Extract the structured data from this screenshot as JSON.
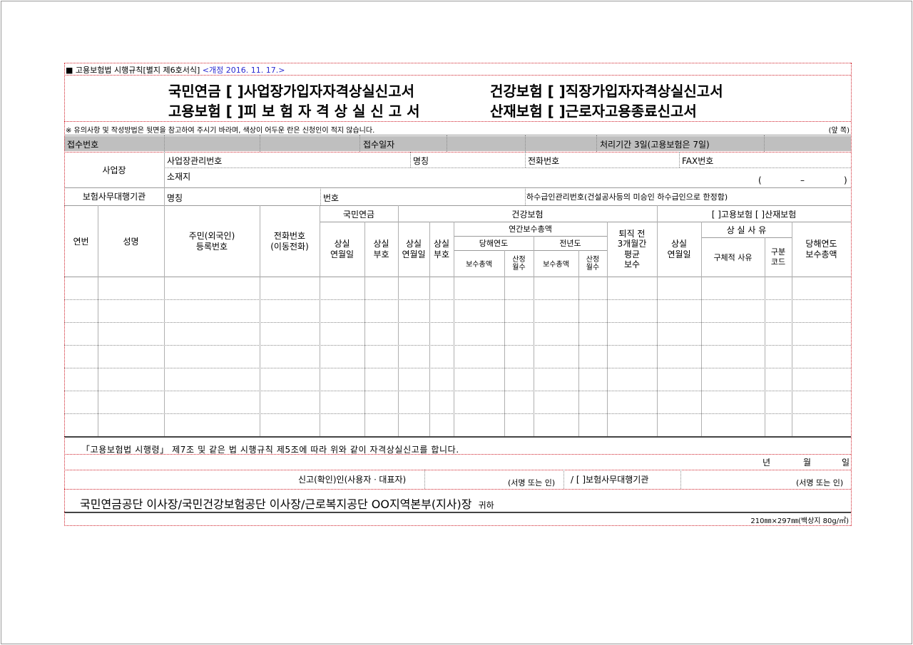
{
  "header": {
    "rule_ref": "■ 고용보험법 시행규칙[별지 제6호서식]",
    "revision": "<개정 2016. 11. 17.>"
  },
  "titles": {
    "left_top": "국민연금 [ ]사업장가입자자격상실신고서",
    "left_bottom": "고용보험 [ ]피 보 험 자 격 상 실 신 고 서",
    "right_top": "건강보험 [ ]직장가입자자격상실신고서",
    "right_bottom": "산재보험 [ ]근로자고용종료신고서"
  },
  "notice": {
    "text": "※ 유의사항 및 작성방법은 뒷면을 참고하여 주시기 바라며, 색상이 어두운 란은 신청인이 적지 않습니다.",
    "side": "(앞 쪽)"
  },
  "reception": {
    "receipt_no": "접수번호",
    "receipt_date": "접수일자",
    "processing": "처리기간 3일(고용보험은 7일)"
  },
  "workplace": {
    "label": "사업장",
    "mgmt_no": "사업장관리번호",
    "name": "명칭",
    "phone": "전화번호",
    "fax": "FAX번호",
    "address": "소재지",
    "paren_open": "(",
    "dash": "–",
    "paren_close": ")"
  },
  "agency": {
    "label": "보험사무대행기관",
    "name": "명칭",
    "number": "번호",
    "subcontract": "하수급인관리번호(건설공사등의 미승인 하수급인으로 한정함)"
  },
  "table_headers": {
    "seq": "연번",
    "name": "성명",
    "resident_no_1": "주민(외국인)",
    "resident_no_2": "등록번호",
    "phone_1": "전화번호",
    "phone_2": "(이동전화)",
    "national_pension": "국민연금",
    "np_loss_date_1": "상실",
    "np_loss_date_2": "연월일",
    "np_loss_code_1": "상실",
    "np_loss_code_2": "부호",
    "health_insurance": "건강보험",
    "hi_loss_date_1": "상실",
    "hi_loss_date_2": "연월일",
    "hi_loss_code_1": "상실",
    "hi_loss_code_2": "부호",
    "annual_pay": "연간보수총액",
    "current_year": "당해연도",
    "previous_year": "전년도",
    "pay_total_cur": "보수총액",
    "months_cur_1": "산정",
    "months_cur_2": "월수",
    "pay_total_prev": "보수총액",
    "months_prev_1": "산정",
    "months_prev_2": "월수",
    "avg_pay_1": "퇴직 전",
    "avg_pay_2": "3개월간",
    "avg_pay_3": "평균",
    "avg_pay_4": "보수",
    "employment_industrial": "[ ]고용보험 [ ]산재보험",
    "ei_loss_date_1": "상실",
    "ei_loss_date_2": "연월일",
    "loss_reason": "상 실 사 유",
    "specific_reason": "구체적 사유",
    "class_code_1": "구분",
    "class_code_2": "코드",
    "cur_year_pay_1": "당해연도",
    "cur_year_pay_2": "보수총액"
  },
  "declaration": {
    "statement": "「고용보험법 시행령」 제7조 및 같은 법 시행규칙 제5조에 따라 위와 같이 자격상실신고를 합니다.",
    "year": "년",
    "month": "월",
    "day": "일",
    "reporter": "신고(확인)인(사용자ㆍ대표자)",
    "sign1": "(서명 또는 인)",
    "slash_agency": "/ [ ]보험사무대행기관",
    "sign2": "(서명 또는 인)"
  },
  "addressee": {
    "main": "국민연금공단 이사장/국민건강보험공단 이사장/근로복지공단 OO지역본부(지사)장",
    "suffix": "귀하"
  },
  "footer": {
    "paper": "210㎜×297㎜(백상지 80g/㎡)"
  }
}
